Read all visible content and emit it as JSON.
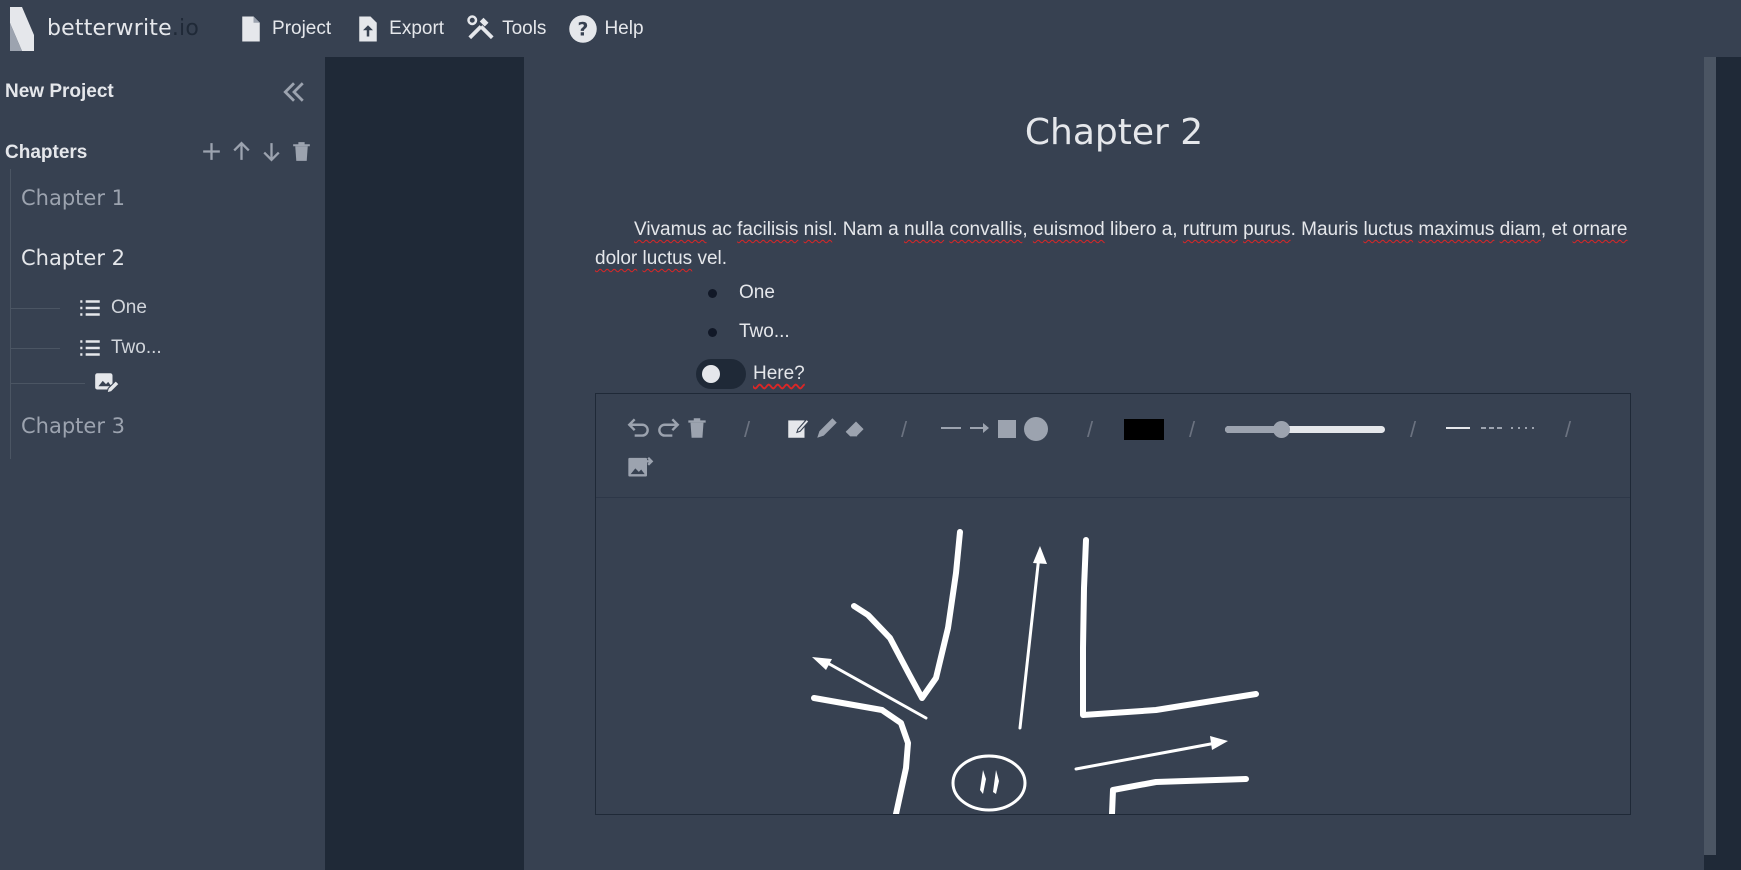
{
  "app": {
    "logo_name": "betterwrite",
    "logo_tld": ".io"
  },
  "menu": [
    {
      "label": "Project",
      "icon": "file-icon"
    },
    {
      "label": "Export",
      "icon": "upload-file-icon"
    },
    {
      "label": "Tools",
      "icon": "tools-icon"
    },
    {
      "label": "Help",
      "icon": "help-icon"
    }
  ],
  "sidebar": {
    "project_title": "New Project",
    "chapters_heading": "Chapters",
    "chapters": [
      {
        "label": "Chapter 1"
      },
      {
        "label": "Chapter 2",
        "subitems": [
          {
            "label": "One"
          },
          {
            "label": "Two..."
          }
        ]
      },
      {
        "label": "Chapter 3"
      }
    ]
  },
  "editor": {
    "chapter_title": "Chapter 2",
    "paragraph": {
      "w1": "Vivamus",
      "w2": "ac",
      "w3": "facilisis",
      "w4": "nisl",
      "w5": ". Nam a",
      "w6": "nulla",
      "w7": "convallis",
      "w8": ",",
      "w9": "euismod",
      "w10": "libero a,",
      "w11": "rutrum",
      "w12": "purus",
      "w13": ". Mauris",
      "w14": "luctus",
      "w15": "maximus",
      "w16": "diam",
      "w17": ", et",
      "w18": "ornare",
      "w19": "dolor",
      "w20": "luctus",
      "w21": "vel."
    },
    "bullets": [
      "One",
      "Two..."
    ],
    "toggle": {
      "label": "Here?",
      "checked": false
    },
    "drawing": {
      "color_swatch": "#000000",
      "stroke_width_fraction": 0.35
    }
  }
}
